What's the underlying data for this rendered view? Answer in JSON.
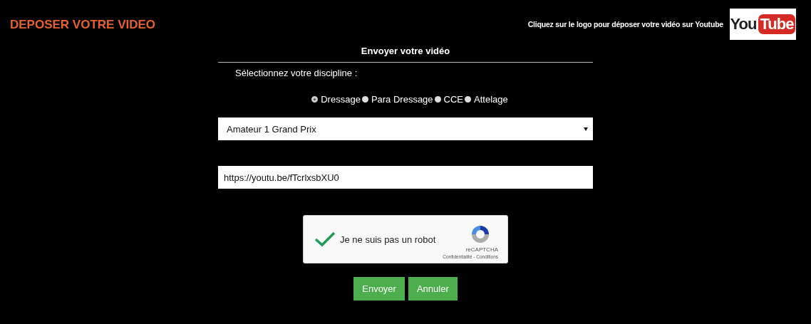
{
  "page_title": "DEPOSER VOTRE VIDEO",
  "youtube_hint": "Cliquez sur le logo pour déposer votre vidéo sur Youtube",
  "logo": {
    "left": "You",
    "right": "Tube"
  },
  "form": {
    "heading": "Envoyer votre vidéo",
    "discipline_label": "Sélectionnez votre discipline :",
    "disciplines": [
      {
        "label": "Dressage",
        "selected": true
      },
      {
        "label": "Para Dressage",
        "selected": false
      },
      {
        "label": "CCE",
        "selected": false
      },
      {
        "label": "Attelage",
        "selected": false
      }
    ],
    "category": {
      "value": "Amateur 1 Grand Prix"
    },
    "video_url": {
      "value": "https://youtu.be/fTcrlxsbXU0"
    },
    "captcha": {
      "label": "Je ne suis pas un robot",
      "checked": true,
      "brand": "reCAPTCHA",
      "links": "Confidentialité - Conditions"
    },
    "buttons": [
      "Envoyer",
      "Annuler"
    ]
  }
}
